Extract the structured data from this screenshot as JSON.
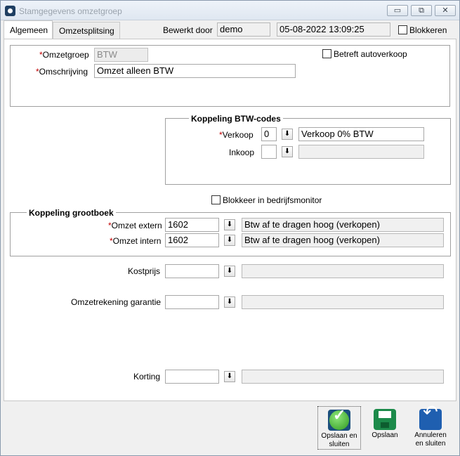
{
  "window": {
    "title": "Stamgegevens omzetgroep",
    "minimize_label": "▭",
    "maximize_label": "⧉",
    "close_label": "✕"
  },
  "tabs": [
    {
      "label": "Algemeen",
      "active": true
    },
    {
      "label": "Omzetsplitsing",
      "active": false
    }
  ],
  "header": {
    "bewerkt_door_label": "Bewerkt door",
    "bewerkt_door_value": "demo",
    "timestamp": "05-08-2022 13:09:25",
    "blokkeren_label": "Blokkeren",
    "blokkeren_checked": false
  },
  "general": {
    "required_mark": "*",
    "omzetgroep_label": "Omzetgroep",
    "omzetgroep_value": "BTW",
    "omschrijving_label": "Omschrijving",
    "omschrijving_value": "Omzet alleen BTW",
    "betreft_autoverkoop_label": "Betreft autoverkoop",
    "betreft_autoverkoop_checked": false
  },
  "btw": {
    "title": "Koppeling BTW-codes",
    "verkoop_label": "Verkoop",
    "verkoop_code": "0",
    "verkoop_desc": "Verkoop 0% BTW",
    "inkoop_label": "Inkoop",
    "inkoop_code": "",
    "inkoop_desc": ""
  },
  "blokkeer_label": "Blokkeer in bedrijfsmonitor",
  "grootboek": {
    "title": "Koppeling grootboek",
    "omzet_extern_label": "Omzet extern",
    "omzet_extern_code": "1602",
    "omzet_extern_desc": "Btw af te dragen hoog (verkopen)",
    "omzet_intern_label": "Omzet intern",
    "omzet_intern_code": "1602",
    "omzet_intern_desc": "Btw af te dragen hoog (verkopen)"
  },
  "other": {
    "kostprijs_label": "Kostprijs",
    "omzetrekening_garantie_label": "Omzetrekening garantie",
    "korting_label": "Korting"
  },
  "lookup_glyph": "⬇",
  "actions": {
    "save_close_line1": "Opslaan en",
    "save_close_line2": "sluiten",
    "save_label": "Opslaan",
    "cancel_line1": "Annuleren",
    "cancel_line2": "en sluiten"
  }
}
